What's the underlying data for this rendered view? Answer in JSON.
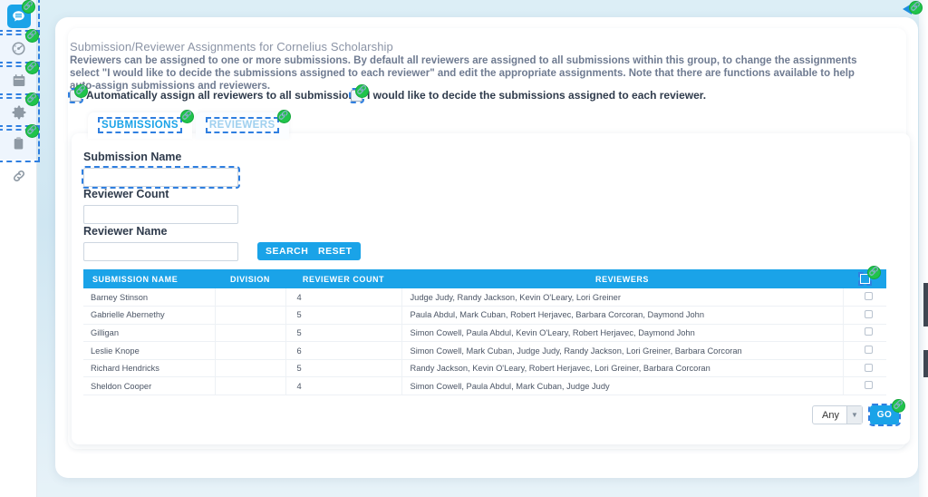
{
  "sidebar": {
    "items": [
      {
        "name": "logo",
        "icon": "chat-bubble-icon",
        "selected": true
      },
      {
        "name": "dashboard",
        "icon": "speedometer-icon",
        "selected": true
      },
      {
        "name": "calendar",
        "icon": "calendar-icon",
        "selected": true
      },
      {
        "name": "settings",
        "icon": "gear-icon",
        "selected": true
      },
      {
        "name": "clipboard",
        "icon": "clipboard-icon",
        "selected": true
      },
      {
        "name": "links",
        "icon": "chain-link-icon",
        "selected": false
      }
    ]
  },
  "page": {
    "title": "Submission/Reviewer Assignments for Cornelius Scholarship",
    "description": "Reviewers can be assigned to one or more submissions. By default all reviewers are assigned to all submissions within this group, to change the assignments select \"I would like to decide the submissions assigned to each reviewer\" and edit the appropriate assignments. Note that there are functions available to help auto-assign submissions and reviewers."
  },
  "options": [
    {
      "label": "Automatically assign all reviewers to all submissions",
      "checked": false
    },
    {
      "label": "I would like to decide the submissions assigned to each reviewer.",
      "checked": false
    }
  ],
  "tabs": [
    {
      "label": "SUBMISSIONS",
      "active": true
    },
    {
      "label": "REVIEWERS",
      "active": false
    }
  ],
  "form": {
    "submission_name_label": "Submission Name",
    "submission_name_value": "",
    "reviewer_count_label": "Reviewer Count",
    "reviewer_count_value": "",
    "reviewer_name_label": "Reviewer Name",
    "reviewer_name_value": "",
    "search_label": "SEARCH",
    "reset_label": "RESET"
  },
  "table": {
    "columns": [
      "SUBMISSION NAME",
      "DIVISION",
      "REVIEWER COUNT",
      "REVIEWERS",
      ""
    ],
    "rows": [
      {
        "submission_name": "Barney Stinson",
        "division": "",
        "reviewer_count": "4",
        "reviewers": "Judge Judy, Randy Jackson, Kevin O'Leary, Lori Greiner",
        "checked": false
      },
      {
        "submission_name": "Gabrielle Abernethy",
        "division": "",
        "reviewer_count": "5",
        "reviewers": "Paula Abdul, Mark Cuban, Robert Herjavec, Barbara Corcoran, Daymond John",
        "checked": false
      },
      {
        "submission_name": "Gilligan",
        "division": "",
        "reviewer_count": "5",
        "reviewers": "Simon Cowell, Paula Abdul, Kevin O'Leary, Robert Herjavec, Daymond John",
        "checked": false
      },
      {
        "submission_name": "Leslie Knope",
        "division": "",
        "reviewer_count": "6",
        "reviewers": "Simon Cowell, Mark Cuban, Judge Judy, Randy Jackson, Lori Greiner, Barbara Corcoran",
        "checked": false
      },
      {
        "submission_name": "Richard Hendricks",
        "division": "",
        "reviewer_count": "5",
        "reviewers": "Randy Jackson, Kevin O'Leary, Robert Herjavec, Lori Greiner, Barbara Corcoran",
        "checked": false
      },
      {
        "submission_name": "Sheldon Cooper",
        "division": "",
        "reviewer_count": "4",
        "reviewers": "Simon Cowell, Paula Abdul, Mark Cuban, Judge Judy",
        "checked": false
      }
    ]
  },
  "footer": {
    "bulk_action_value": "Any",
    "bulk_action_options": [
      "Any"
    ],
    "go_label": "GO"
  },
  "colors": {
    "accent": "#1aa3e8",
    "badge": "#20c44b",
    "selection_outline": "#2f7fe0",
    "text_muted": "#8b94a6",
    "desc_text": "#6f7b91"
  }
}
